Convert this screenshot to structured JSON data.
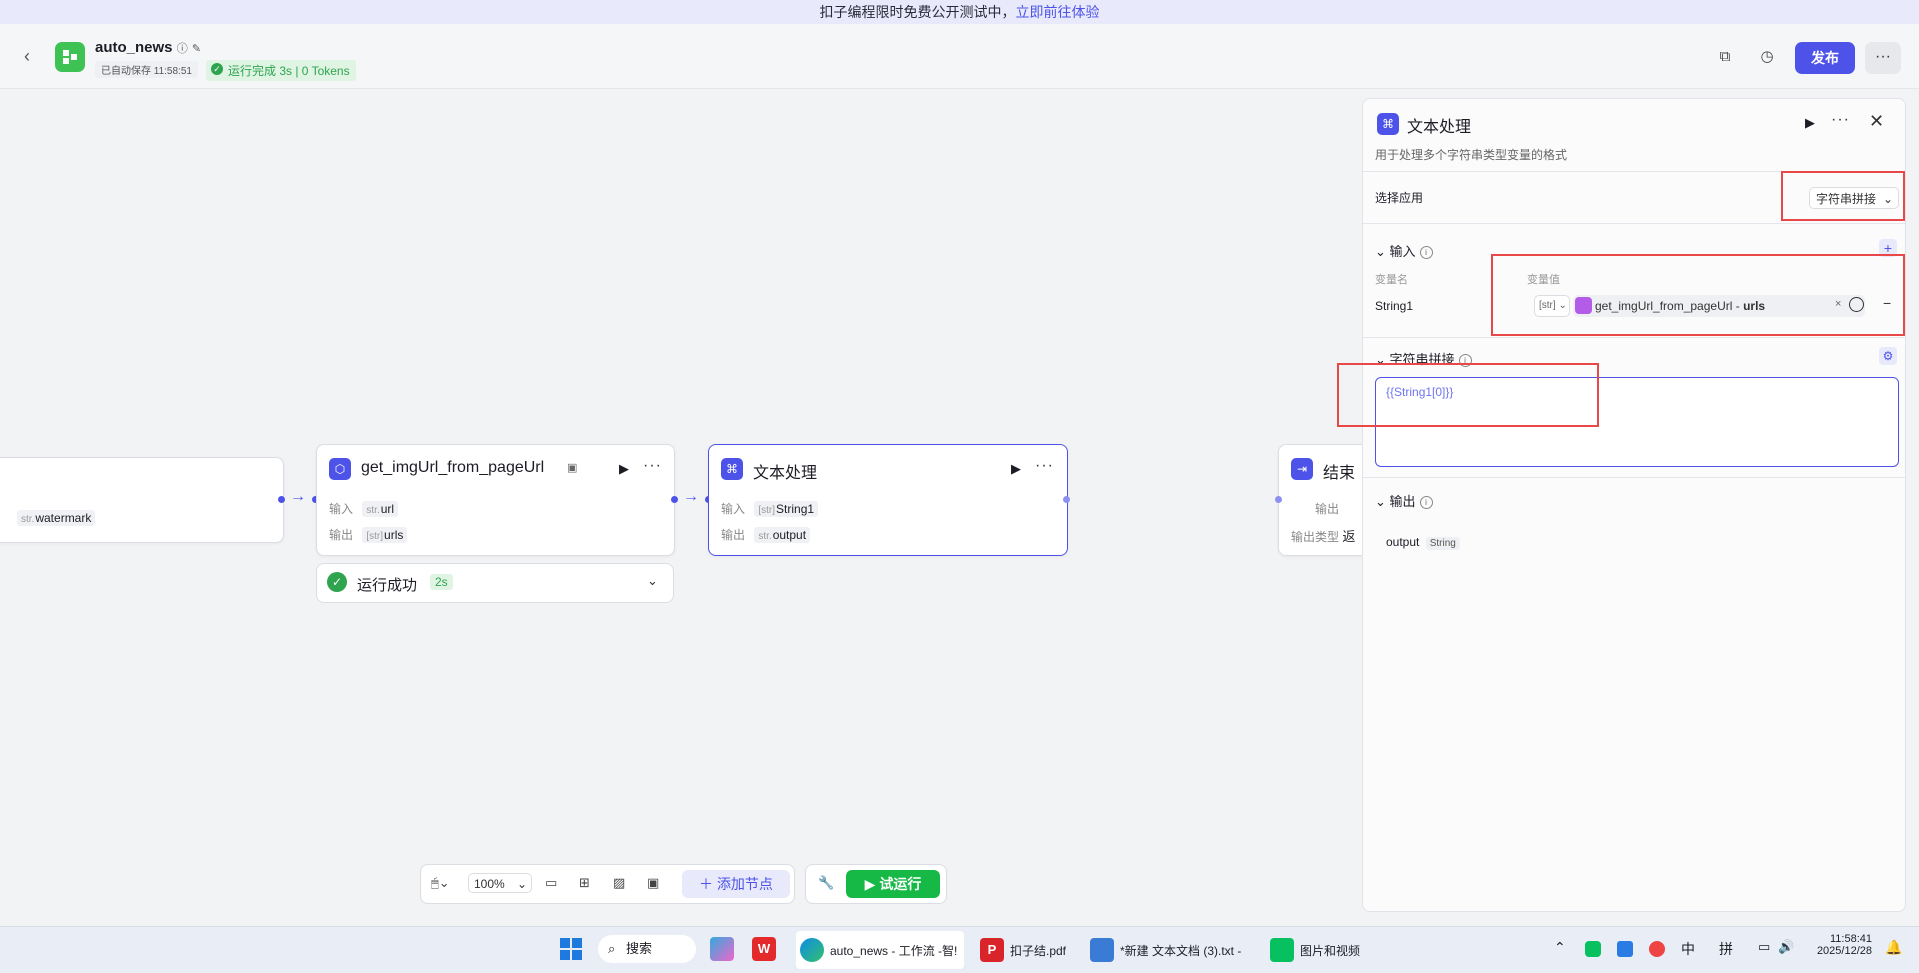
{
  "banner": {
    "text": "扣子编程限时免费公开测试中，",
    "link": "立即前往体验"
  },
  "header": {
    "app_name": "auto_news",
    "saved": "已自动保存 11:58:51",
    "run_status": "运行完成 3s | 0 Tokens",
    "publish": "发布",
    "more": "···"
  },
  "nodes": {
    "partial": {
      "chip_type": "str.",
      "chip_name": "watermark"
    },
    "get_img": {
      "title": "get_imgUrl_from_pageUrl",
      "in_label": "输入",
      "in_type": "str.",
      "in_name": "url",
      "out_label": "输出",
      "out_type": "[str]",
      "out_name": "urls",
      "run_status": "运行成功",
      "run_time": "2s"
    },
    "text_proc": {
      "title": "文本处理",
      "in_label": "输入",
      "in_type": "[str]",
      "in_name": "String1",
      "out_label": "输出",
      "out_type": "str.",
      "out_name": "output"
    },
    "end": {
      "title": "结束",
      "out_label": "输出",
      "out_type_label": "输出类型",
      "out_type_value": "返"
    }
  },
  "toolbar": {
    "zoom": "100%",
    "add_node": "添加节点",
    "trial_run": "试运行"
  },
  "panel": {
    "title": "文本处理",
    "desc": "用于处理多个字符串类型变量的格式",
    "select_label": "选择应用",
    "select_value": "字符串拼接",
    "input_title": "输入",
    "var_name_header": "变量名",
    "var_value_header": "变量值",
    "var_name": "String1",
    "var_type": "[str]",
    "var_ref_node": "get_imgUrl_from_pageUrl",
    "var_ref_sep": "-",
    "var_ref_field": "urls",
    "concat_title": "字符串拼接",
    "template": "{{String1[0]}}",
    "output_title": "输出",
    "output_name": "output",
    "output_type": "String"
  },
  "taskbar": {
    "search": "搜索",
    "items": [
      "auto_news - 工作流 -智!",
      "扣子结.pdf",
      "*新建 文本文档 (3).txt - ",
      "图片和视频"
    ],
    "ime1": "中",
    "ime2": "拼",
    "time": "11:58:41",
    "date": "2025/12/28"
  },
  "colors": {
    "accent": "#4d53e8",
    "success": "#17b946",
    "highlight": "#e84848"
  }
}
